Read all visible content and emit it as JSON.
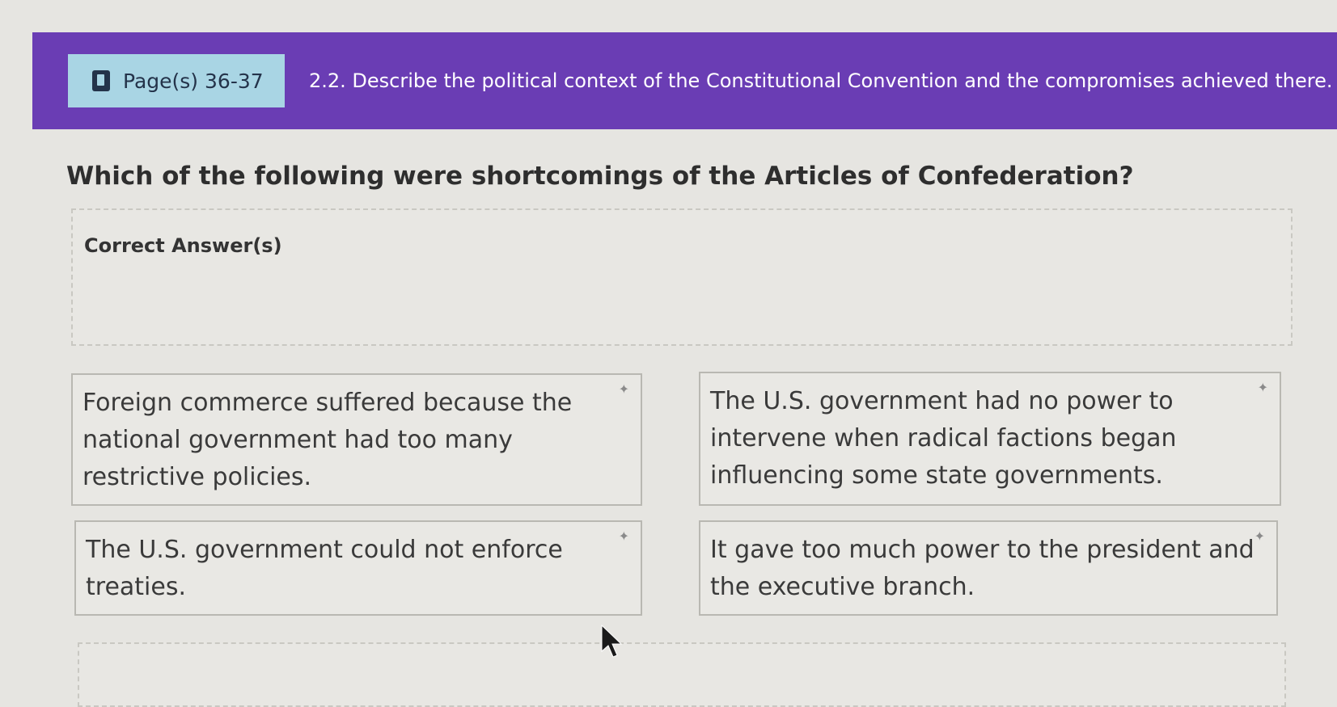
{
  "header": {
    "page_ref": "Page(s) 36-37",
    "page_icon": "book-icon",
    "objective": "2.2. Describe the political context of the Constitutional Convention and the compromises achieved there."
  },
  "question": {
    "text": "Which of the following were shortcomings of the Articles of Confederation?",
    "answer_label": "Correct Answer(s)"
  },
  "options": [
    {
      "text": "Foreign commerce suffered because the national government had too many restrictive policies."
    },
    {
      "text": "The U.S. government had no power to intervene when radical factions began influencing some state governments."
    },
    {
      "text": "The U.S. government could not enforce treaties."
    },
    {
      "text": "It gave too much power to the president and the executive branch."
    }
  ],
  "colors": {
    "banner": "#6a3db4",
    "page_chip": "#a9d5e4"
  }
}
